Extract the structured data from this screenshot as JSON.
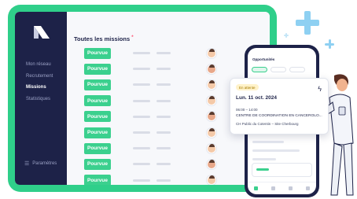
{
  "sidebar": {
    "items": [
      {
        "label": "Mon réseau",
        "active": false
      },
      {
        "label": "Recrutement",
        "active": false
      },
      {
        "label": "Missions",
        "active": true
      },
      {
        "label": "Statistiques",
        "active": false
      }
    ],
    "settings_label": "Paramètres",
    "settings_icon": "menu-icon"
  },
  "main": {
    "title": "Toutes les missions",
    "title_marker": "*",
    "rows": [
      {
        "status": "Pourvue"
      },
      {
        "status": "Pourvue"
      },
      {
        "status": "Pourvue"
      },
      {
        "status": "Pourvue"
      },
      {
        "status": "Pourvue"
      },
      {
        "status": "Pourvue"
      },
      {
        "status": "Pourvue"
      },
      {
        "status": "Pourvue"
      },
      {
        "status": "Pourvue"
      },
      {
        "status": "Pourvue"
      }
    ]
  },
  "phone": {
    "header": "Opportunités"
  },
  "card": {
    "status_pill": "En attente",
    "date": "Lun. 11 oct. 2024",
    "time": "06:00 – 14:00",
    "place": "CENTRE DE COORDINATION EN CANCEROLO...",
    "site": "CH Public du Cotentin – Site Cherbourg"
  },
  "colors": {
    "accent_green": "#3bd08e",
    "frame_green": "#2fcf8a",
    "navy": "#1d2248",
    "cross_blue": "#8ed0f2"
  }
}
